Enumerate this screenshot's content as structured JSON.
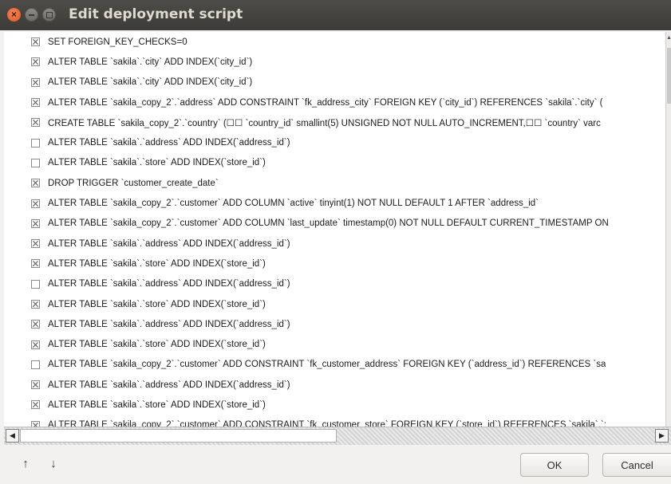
{
  "window": {
    "title": "Edit deployment script"
  },
  "statements": [
    {
      "checked": true,
      "text": "SET FOREIGN_KEY_CHECKS=0"
    },
    {
      "checked": true,
      "text": "ALTER TABLE `sakila`.`city` ADD INDEX(`city_id`)"
    },
    {
      "checked": true,
      "text": "ALTER TABLE `sakila`.`city` ADD INDEX(`city_id`)"
    },
    {
      "checked": true,
      "text": "ALTER TABLE `sakila_copy_2`.`address` ADD CONSTRAINT `fk_address_city` FOREIGN KEY (`city_id`) REFERENCES `sakila`.`city` ("
    },
    {
      "checked": true,
      "text": "CREATE TABLE `sakila_copy_2`.`country` (☐☐ `country_id` smallint(5) UNSIGNED NOT NULL AUTO_INCREMENT,☐☐ `country` varc"
    },
    {
      "checked": false,
      "text": "ALTER TABLE `sakila`.`address` ADD INDEX(`address_id`)"
    },
    {
      "checked": false,
      "text": "ALTER TABLE `sakila`.`store` ADD INDEX(`store_id`)"
    },
    {
      "checked": true,
      "text": "DROP TRIGGER `customer_create_date`"
    },
    {
      "checked": true,
      "text": "ALTER TABLE `sakila_copy_2`.`customer` ADD COLUMN `active` tinyint(1) NOT NULL DEFAULT 1 AFTER `address_id`"
    },
    {
      "checked": true,
      "text": "ALTER TABLE `sakila_copy_2`.`customer` ADD COLUMN `last_update` timestamp(0) NOT NULL DEFAULT CURRENT_TIMESTAMP ON"
    },
    {
      "checked": true,
      "text": "ALTER TABLE `sakila`.`address` ADD INDEX(`address_id`)"
    },
    {
      "checked": true,
      "text": "ALTER TABLE `sakila`.`store` ADD INDEX(`store_id`)"
    },
    {
      "checked": false,
      "text": "ALTER TABLE `sakila`.`address` ADD INDEX(`address_id`)"
    },
    {
      "checked": true,
      "text": "ALTER TABLE `sakila`.`store` ADD INDEX(`store_id`)"
    },
    {
      "checked": true,
      "text": "ALTER TABLE `sakila`.`address` ADD INDEX(`address_id`)"
    },
    {
      "checked": true,
      "text": "ALTER TABLE `sakila`.`store` ADD INDEX(`store_id`)"
    },
    {
      "checked": false,
      "text": "ALTER TABLE `sakila_copy_2`.`customer` ADD CONSTRAINT `fk_customer_address` FOREIGN KEY (`address_id`) REFERENCES `sa"
    },
    {
      "checked": true,
      "text": "ALTER TABLE `sakila`.`address` ADD INDEX(`address_id`)"
    },
    {
      "checked": true,
      "text": "ALTER TABLE `sakila`.`store` ADD INDEX(`store_id`)"
    },
    {
      "checked": true,
      "text": "ALTER TABLE `sakila_copy_2`.`customer` ADD CONSTRAINT `fk_customer_store` FOREIGN KEY (`store_id`) REFERENCES `sakila`.`:"
    }
  ],
  "footer": {
    "move_up_icon": "↑",
    "move_down_icon": "↓",
    "ok_label": "OK",
    "cancel_label": "Cancel"
  },
  "icons": {
    "close": "close-icon",
    "minimize": "minimize-icon",
    "maximize": "maximize-icon",
    "scroll_left": "chevron-left-icon",
    "scroll_right": "chevron-right-icon",
    "scroll_up": "chevron-up-icon"
  },
  "colors": {
    "titlebar": "#3c3b37",
    "close_button": "#e2501b",
    "background": "#f2f1f0",
    "list_background": "#ffffff"
  }
}
